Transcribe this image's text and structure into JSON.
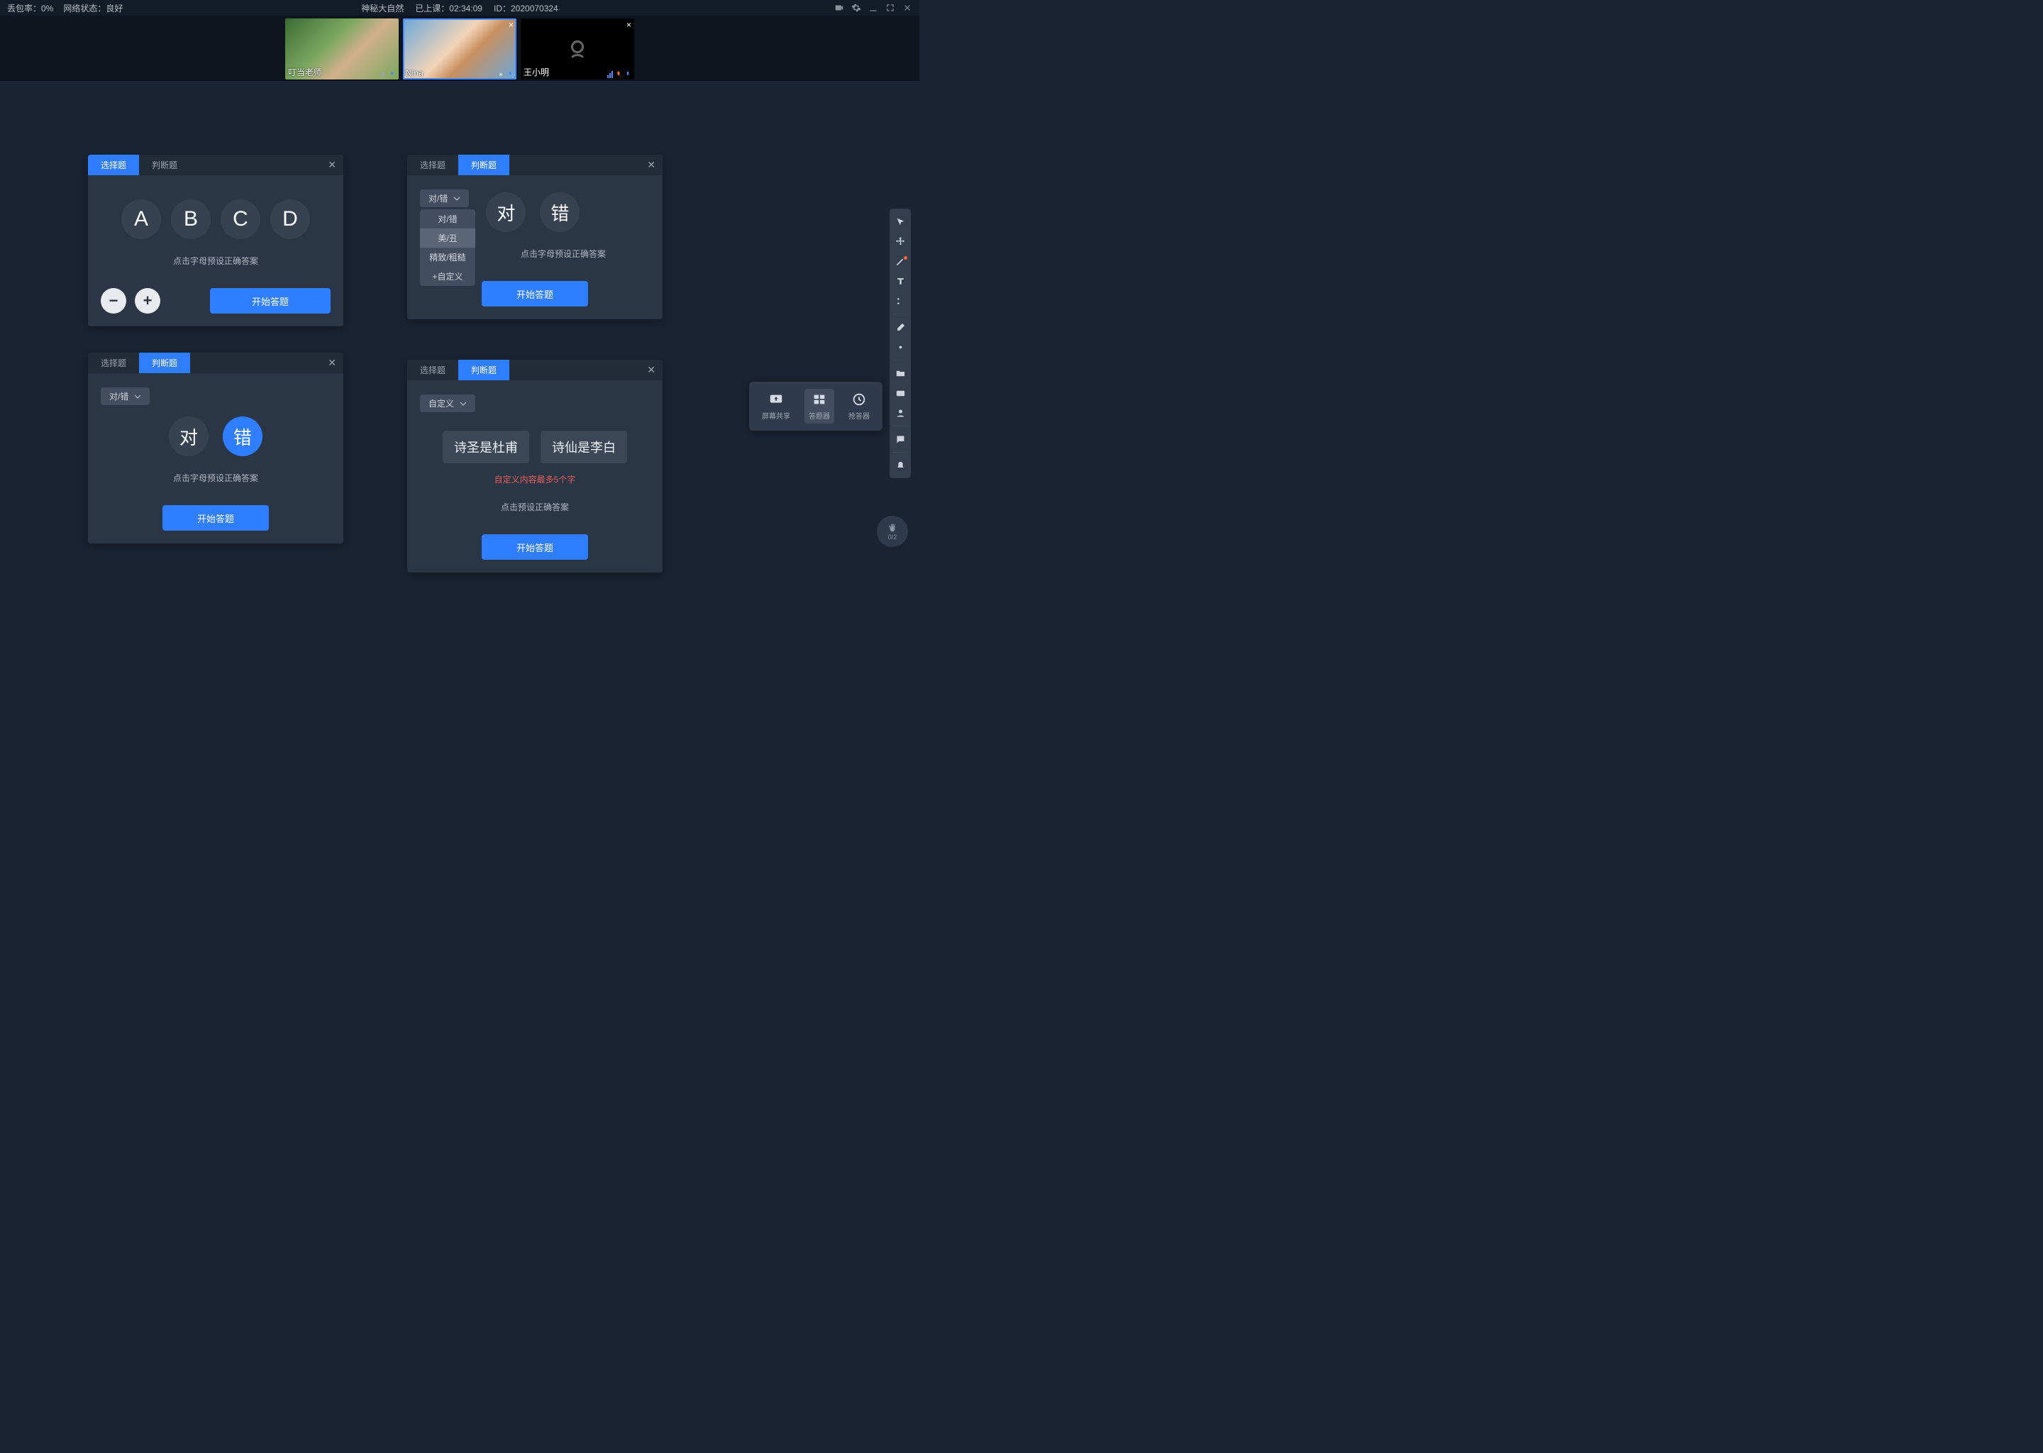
{
  "topbar": {
    "packet_loss_label": "丢包率：0%",
    "network_label": "网络状态：良好",
    "title": "神秘大自然",
    "class_time_label": "已上课：02:34:09",
    "id_label": "ID：2020070324"
  },
  "participants": [
    {
      "name": "叮当老师",
      "camera": "on",
      "active": false
    },
    {
      "name": "Nina",
      "camera": "on",
      "active": true
    },
    {
      "name": "王小明",
      "camera": "off",
      "active": false
    }
  ],
  "panel1": {
    "tab_choice": "选择题",
    "tab_judge": "判断题",
    "answers": [
      "A",
      "B",
      "C",
      "D"
    ],
    "hint": "点击字母预设正确答案",
    "start": "开始答题"
  },
  "panel2": {
    "tab_choice": "选择题",
    "tab_judge": "判断题",
    "dd_label": "对/错",
    "dd_options": [
      "对/错",
      "美/丑",
      "精致/粗糙",
      "+自定义"
    ],
    "tf": [
      "对",
      "错"
    ],
    "hint": "点击字母预设正确答案",
    "start": "开始答题"
  },
  "panel3": {
    "tab_choice": "选择题",
    "tab_judge": "判断题",
    "dd_label": "对/错",
    "tf": [
      "对",
      "错"
    ],
    "hint": "点击字母预设正确答案",
    "start": "开始答题"
  },
  "panel4": {
    "tab_choice": "选择题",
    "tab_judge": "判断题",
    "dd_label": "自定义",
    "options": [
      "诗圣是杜甫",
      "诗仙是李白"
    ],
    "warn": "自定义内容最多5个字",
    "hint": "点击预设正确答案",
    "start": "开始答题"
  },
  "popup": {
    "screen_share": "屏幕共享",
    "answer_tool": "答题器",
    "buzzer": "抢答器"
  },
  "hand": {
    "count": "0/2"
  }
}
